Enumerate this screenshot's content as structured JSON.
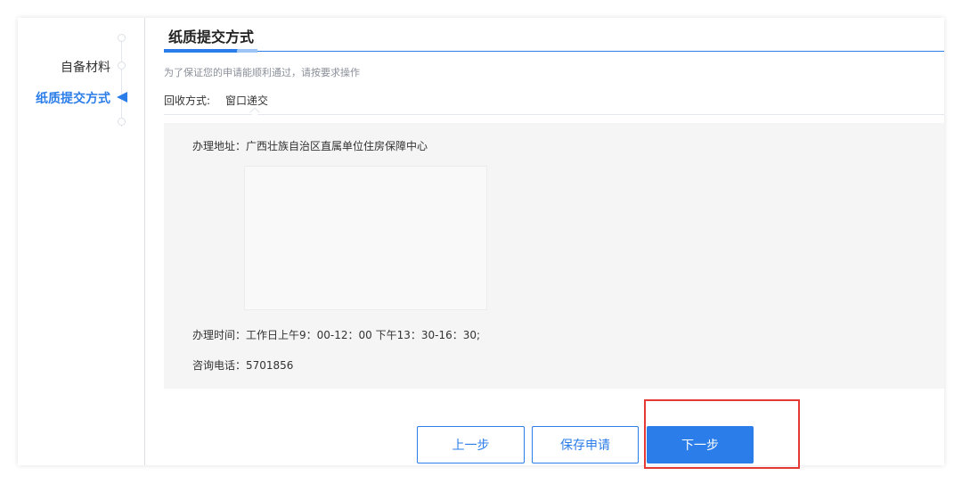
{
  "sidebar": {
    "items": [
      {
        "label": "自备材料"
      },
      {
        "label": "纸质提交方式"
      }
    ]
  },
  "main": {
    "section_title": "纸质提交方式",
    "hint": "为了保证您的申请能顺利通过，请按要求操作",
    "recycle": {
      "label": "回收方式:",
      "value": "窗口递交"
    },
    "info": {
      "address": "办理地址：广西壮族自治区直属单位住房保障中心",
      "hours": "办理时间：工作日上午9：00-12：00 下午13：30-16：30;",
      "phone": "咨询电话：5701856"
    }
  },
  "buttons": {
    "prev": "上一步",
    "save": "保存申请",
    "next": "下一步"
  },
  "colors": {
    "accent": "#2b7de9",
    "highlight": "#e53935",
    "panel_bg": "#f5f5f5"
  }
}
